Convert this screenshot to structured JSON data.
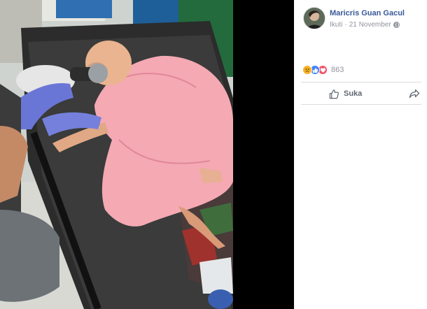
{
  "post": {
    "author": "Maricris Guan Gacul",
    "follow_label": "Ikuti",
    "separator": "·",
    "date": "21 November",
    "privacy_icon": "globe-icon"
  },
  "reactions": {
    "icons": [
      "sad-reaction-icon",
      "like-reaction-icon",
      "love-reaction-icon"
    ],
    "count": "863"
  },
  "actions": {
    "like_label": "Suka",
    "like_icon": "thumbs-up-icon",
    "share_icon": "share-arrow-icon"
  },
  "colors": {
    "author": "#385898",
    "meta": "#90949c",
    "like_action": "#606770",
    "viewer_bg": "#000000"
  }
}
